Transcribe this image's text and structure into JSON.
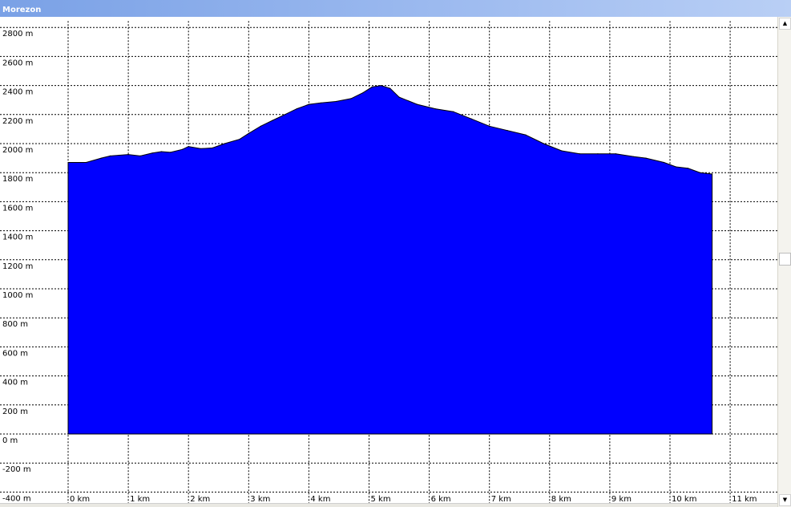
{
  "window": {
    "title": "Morezon"
  },
  "scrollbar": {
    "up_icon": "arrow-up-icon",
    "down_icon": "arrow-down-icon",
    "up_glyph": "▲",
    "down_glyph": "▼"
  },
  "chart_data": {
    "type": "area",
    "title": "",
    "xlabel": "",
    "ylabel": "",
    "xlim": [
      0,
      11.5
    ],
    "ylim": [
      -400,
      2800
    ],
    "grid": true,
    "fill_color": "#0000ff",
    "x_ticks": [
      "0 km",
      "1 km",
      "2 km",
      "3 km",
      "4 km",
      "5 km",
      "6 km",
      "7 km",
      "8 km",
      "9 km",
      "10 km",
      "11 km"
    ],
    "y_ticks": [
      "-400 m",
      "-200 m",
      "0 m",
      "200 m",
      "400 m",
      "600 m",
      "800 m",
      "1000 m",
      "1200 m",
      "1400 m",
      "1600 m",
      "1800 m",
      "2000 m",
      "2200 m",
      "2400 m",
      "2600 m",
      "2800 m"
    ],
    "series": [
      {
        "x": [
          0,
          0.3,
          0.55,
          0.7,
          0.85,
          1.0,
          1.2,
          1.4,
          1.55,
          1.7,
          1.9,
          2.0,
          2.2,
          2.4,
          2.6,
          2.85,
          3.0,
          3.2,
          3.4,
          3.6,
          3.8,
          4.0,
          4.2,
          4.45,
          4.7,
          4.9,
          5.05,
          5.2,
          5.35,
          5.5,
          5.8,
          6.1,
          6.4,
          6.7,
          7.0,
          7.3,
          7.6,
          7.9,
          8.2,
          8.5,
          8.8,
          9.1,
          9.4,
          9.6,
          9.9,
          10.1,
          10.3,
          10.5,
          10.7
        ],
        "y": [
          1870,
          1870,
          1900,
          1915,
          1920,
          1925,
          1915,
          1935,
          1945,
          1940,
          1960,
          1980,
          1965,
          1970,
          2000,
          2030,
          2070,
          2120,
          2160,
          2200,
          2240,
          2270,
          2280,
          2290,
          2310,
          2350,
          2390,
          2400,
          2380,
          2320,
          2270,
          2240,
          2220,
          2170,
          2120,
          2090,
          2060,
          2000,
          1950,
          1930,
          1930,
          1930,
          1910,
          1900,
          1870,
          1840,
          1830,
          1800,
          1790
        ]
      }
    ]
  }
}
